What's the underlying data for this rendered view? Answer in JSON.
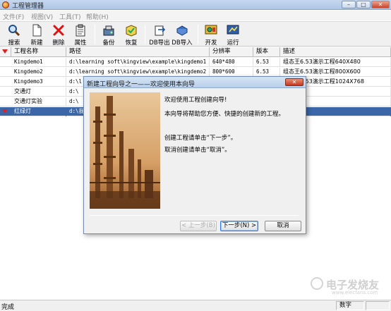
{
  "window": {
    "title": "工程管理器",
    "min": "–",
    "max": "□",
    "close": "✕"
  },
  "menu": [
    "文件(F)",
    "视图(V)",
    "工具(T)",
    "帮助(H)"
  ],
  "toolbar": {
    "buttons": [
      "搜索",
      "新建",
      "删除",
      "属性",
      "备份",
      "恢复",
      "DB导出",
      "DB导入",
      "开发",
      "运行"
    ]
  },
  "table": {
    "headers": [
      "工程名称",
      "路径",
      "分辨率",
      "版本",
      "描述"
    ],
    "rows": [
      {
        "name": "Kingdemo1",
        "path": "d:\\learning soft\\kingview\\example\\kingdemo1",
        "res": "640*480",
        "ver": "6.53",
        "desc": "组态王6.53演示工程640X480"
      },
      {
        "name": "Kingdemo2",
        "path": "d:\\learning soft\\kingview\\example\\kingdemo2",
        "res": "800*600",
        "ver": "6.53",
        "desc": "组态王6.53演示工程800X600"
      },
      {
        "name": "Kingdemo3",
        "path": "d:\\l",
        "res": "",
        "ver": "",
        "desc": "组态王6.53演示工程1024X768"
      },
      {
        "name": "交通灯",
        "path": "d:\\",
        "res": "",
        "ver": "",
        "desc": "灯实验。"
      },
      {
        "name": "交通灯实验",
        "path": "d:\\",
        "res": "",
        "ver": "",
        "desc": "灯"
      },
      {
        "name": "红绿灯",
        "path": "d:\\我",
        "res": "",
        "ver": "",
        "desc": ""
      }
    ]
  },
  "dialog": {
    "title": "新建工程向导之一——欢迎使用本向导",
    "welcome": "欢迎使用工程创建向导!",
    "intro": "本向导将帮助您方便、快捷的创建新的工程。",
    "line_next": "创建工程请单击“下一步”。",
    "line_cancel": "取消创建请单击“取消”。",
    "btn_back": "< 上一步(B)",
    "btn_next": "下一步(N) >",
    "btn_cancel": "取消",
    "close": "✕"
  },
  "status": {
    "text": "完成",
    "panel": "数字"
  },
  "watermark": {
    "text": "电子发烧友",
    "url": "www.elecfans.com"
  }
}
